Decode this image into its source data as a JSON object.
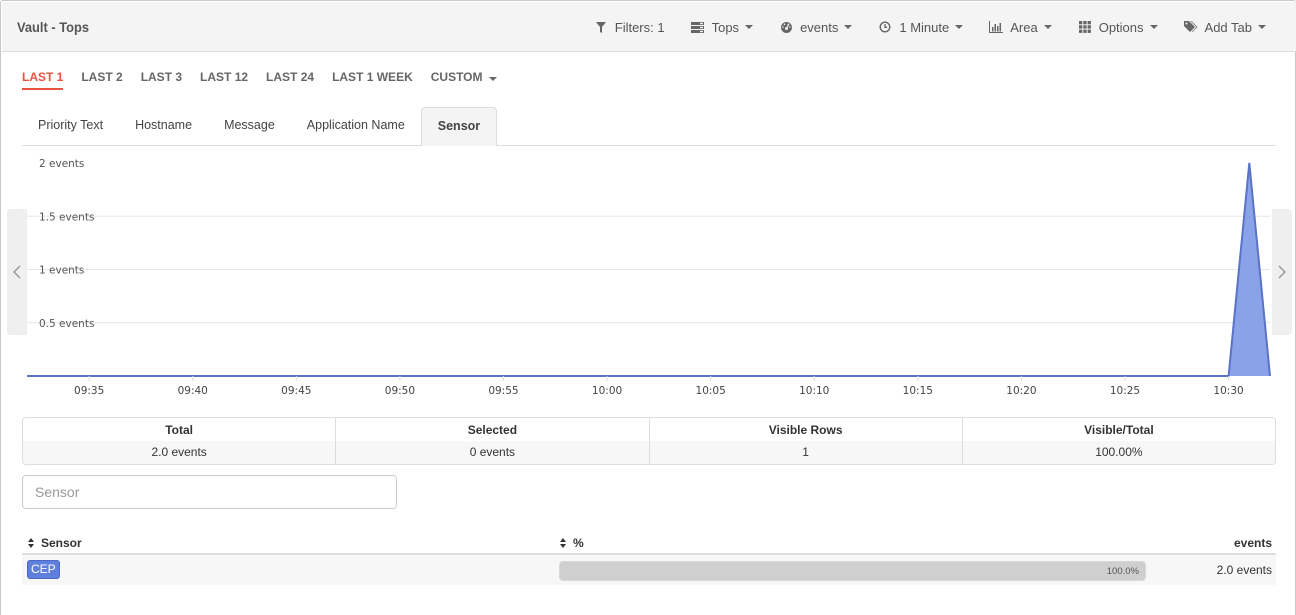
{
  "header": {
    "title": "Vault - Tops",
    "toolbar": [
      {
        "label": "Filters: 1",
        "icon": "filter-icon",
        "caret": false
      },
      {
        "label": "Tops",
        "icon": "list-icon",
        "caret": true
      },
      {
        "label": "events",
        "icon": "dashboard-icon",
        "caret": true
      },
      {
        "label": "1 Minute",
        "icon": "clock-icon",
        "caret": true
      },
      {
        "label": "Area",
        "icon": "bar-chart-icon",
        "caret": true
      },
      {
        "label": "Options",
        "icon": "grid-icon",
        "caret": true
      },
      {
        "label": "Add Tab",
        "icon": "tags-icon",
        "caret": true
      }
    ]
  },
  "ranges": {
    "items": [
      "LAST 1",
      "LAST 2",
      "LAST 3",
      "LAST 12",
      "LAST 24",
      "LAST 1 WEEK",
      "CUSTOM"
    ],
    "active": "LAST 1"
  },
  "tabs": {
    "items": [
      "Priority Text",
      "Hostname",
      "Message",
      "Application Name",
      "Sensor"
    ],
    "active": "Sensor"
  },
  "colors": {
    "accent": "#e8533f",
    "series_fill": "#8aa2e8",
    "series_line": "#5b73c7",
    "badge": "#5f7fdc"
  },
  "chart_data": {
    "type": "area",
    "title": "",
    "xlabel": "",
    "ylabel": "",
    "x_domain": [
      "09:32",
      "10:32"
    ],
    "ylim": [
      0,
      2
    ],
    "y_ticks": [
      {
        "value": 0.5,
        "label": "0.5 events"
      },
      {
        "value": 1,
        "label": "1 events"
      },
      {
        "value": 1.5,
        "label": "1.5 events"
      },
      {
        "value": 2,
        "label": "2 events"
      }
    ],
    "x_ticks": [
      "09:35",
      "09:40",
      "09:45",
      "09:50",
      "09:55",
      "10:00",
      "10:05",
      "10:10",
      "10:15",
      "10:20",
      "10:25",
      "10:30"
    ],
    "grid": true,
    "legend": "none",
    "series": [
      {
        "name": "CEP",
        "points": [
          {
            "x": "09:32",
            "y": 0
          },
          {
            "x": "10:30",
            "y": 0
          },
          {
            "x": "10:31",
            "y": 2
          },
          {
            "x": "10:32",
            "y": 0
          }
        ]
      }
    ]
  },
  "summary": {
    "columns": [
      {
        "header": "Total",
        "value": "2.0 events"
      },
      {
        "header": "Selected",
        "value": "0 events"
      },
      {
        "header": "Visible Rows",
        "value": "1"
      },
      {
        "header": "Visible/Total",
        "value": "100.00%"
      }
    ]
  },
  "search": {
    "placeholder": "Sensor",
    "value": ""
  },
  "table": {
    "headers": {
      "name": "Sensor",
      "percent": "%",
      "count": "events"
    },
    "rows": [
      {
        "name": "CEP",
        "percent": 100.0,
        "percent_label": "100.0%",
        "count": "2.0 events"
      }
    ]
  }
}
